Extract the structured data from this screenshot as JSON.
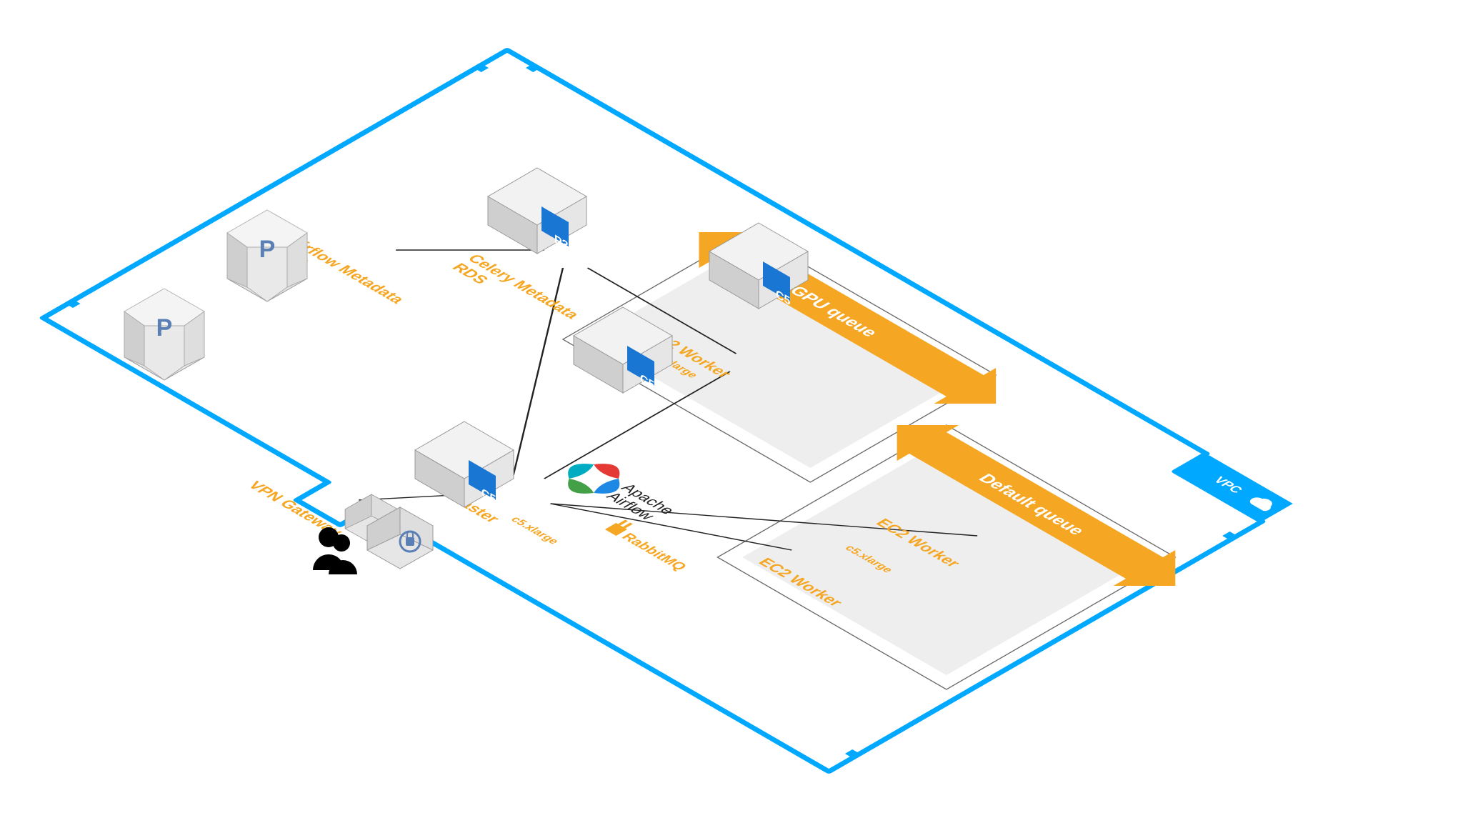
{
  "vpc": {
    "label": "VPC"
  },
  "queues": {
    "gpu": {
      "label": "GPU queue"
    },
    "default": {
      "label": "Default queue"
    }
  },
  "nodes": {
    "airflow_rds": {
      "label_l1": "Airflow Metadata",
      "label_l2": "RDS",
      "badge": "P"
    },
    "celery_rds": {
      "label_l1": "Celery Metadata",
      "label_l2": "RDS",
      "badge": "P"
    },
    "gpu_worker": {
      "label": "EC2 Worker",
      "instance": "p3.2xlarge",
      "badge": "P3"
    },
    "def_worker1": {
      "label": "EC2 Worker",
      "instance": "c5.xlarge",
      "badge": "C5"
    },
    "def_worker2": {
      "label": "EC2 Worker",
      "badge": "C5"
    },
    "master": {
      "label": "EC2 Master",
      "instance": "c5.xlarge",
      "badge": "C5"
    },
    "vpn": {
      "label": "VPN Gateway"
    }
  },
  "logos": {
    "airflow_top": "Apache",
    "airflow": "Airflow",
    "rabbitmq": "RabbitMQ"
  },
  "colors": {
    "vpc_stroke": "#00a8ff",
    "queue_fill": "#f5a623",
    "node_face": "#e6e6e6",
    "node_side": "#cfcfcf",
    "node_top": "#f2f2f2",
    "badge_fill": "#1976d2",
    "group_fill": "#eeeeee",
    "link": "#222"
  }
}
